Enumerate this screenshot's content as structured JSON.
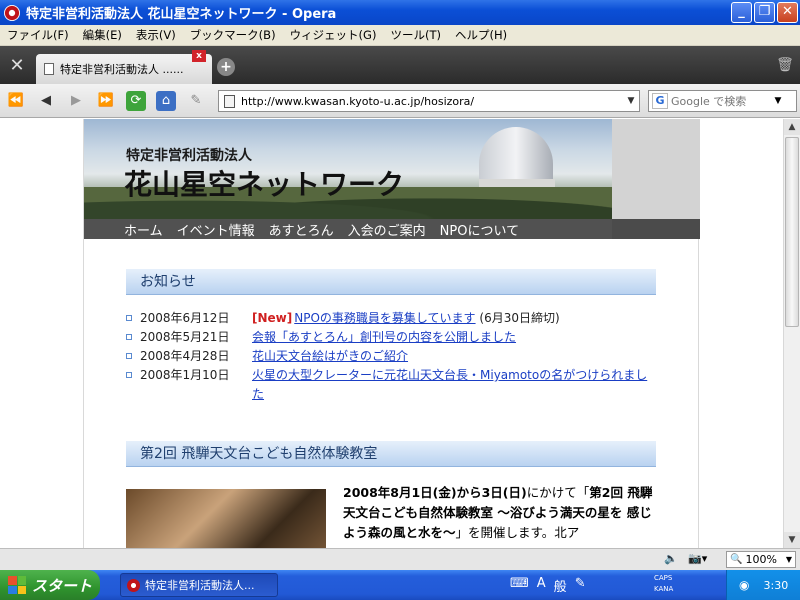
{
  "window": {
    "title": "特定非営利活動法人 花山星空ネットワーク - Opera",
    "minimize": "_",
    "maximize": "❐",
    "close": "✕"
  },
  "menu": [
    "ファイル(F)",
    "編集(E)",
    "表示(V)",
    "ブックマーク(B)",
    "ウィジェット(G)",
    "ツール(T)",
    "ヘルプ(H)"
  ],
  "tabs": {
    "active_label": "特定非営利活動法人 ......",
    "close": "x",
    "new_tab": "+"
  },
  "toolbar": {
    "address": "http://www.kwasan.kyoto-u.ac.jp/hosizora/",
    "search_placeholder": "Google で検索",
    "search_engine_glyph": "G"
  },
  "site": {
    "subtitle": "特定非営利活動法人",
    "title": "花山星空ネットワーク",
    "nav": [
      "ホーム",
      "イベント情報",
      "あすとろん",
      "入会のご案内",
      "NPOについて"
    ]
  },
  "news": {
    "heading": "お知らせ",
    "items": [
      {
        "date": "2008年6月12日",
        "new": "[New]",
        "link": "NPOの事務職員を募集しています",
        "note": "(6月30日締切)"
      },
      {
        "date": "2008年5月21日",
        "new": "",
        "link": "会報「あすとろん」創刊号の内容を公開しました",
        "note": ""
      },
      {
        "date": "2008年4月28日",
        "new": "",
        "link": "花山天文台絵はがきのご紹介",
        "note": ""
      },
      {
        "date": "2008年1月10日",
        "new": "",
        "link": "火星の大型クレーターに元花山天文台長・Miyamotoの名がつけられました",
        "note": ""
      }
    ]
  },
  "event": {
    "heading": "第2回 飛騨天文台こども自然体験教室",
    "text_bold": "2008年8月1日(金)から3日(日)",
    "text_1": "にかけて「",
    "text_bold2": "第2回 飛騨天文台こども自然体験教室 ～浴びよう満天の星を 感じよう森の風と水を～",
    "text_2": "」を開催します。北ア"
  },
  "statusbar": {
    "zoom": "100%"
  },
  "taskbar": {
    "start": "スタート",
    "task_label": "特定非営利活動法人...",
    "ime": [
      "A",
      "般"
    ],
    "caps": "CAPS",
    "kana": "KANA",
    "clock": "3:30"
  }
}
